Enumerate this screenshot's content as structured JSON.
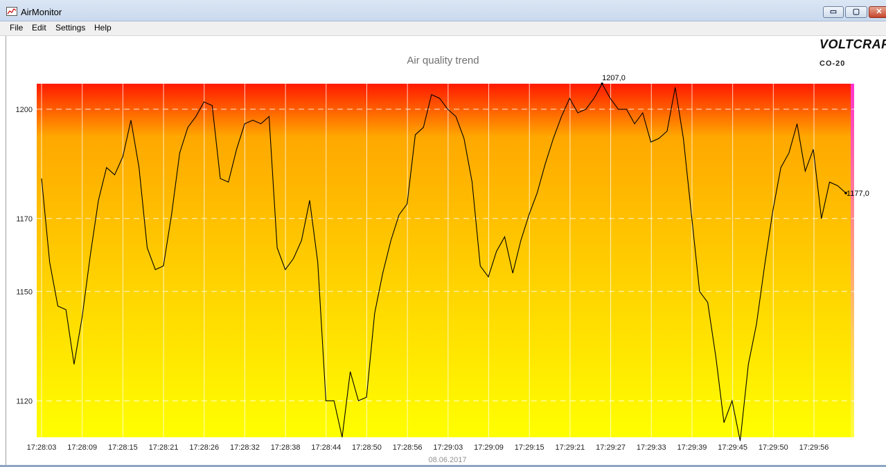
{
  "window": {
    "title": "AirMonitor",
    "min_glyph": "▭",
    "max_glyph": "▢",
    "close_glyph": "✕"
  },
  "menu": [
    "File",
    "Edit",
    "Settings",
    "Help"
  ],
  "brand": {
    "name": "VOLTCRAFT",
    "model": "CO-20"
  },
  "colors": {
    "gradient_top": "#ff1a00",
    "gradient_mid": "#ffa800",
    "gradient_bottom": "#ffff00",
    "right_edge": "#ff33cc",
    "line": "#000000"
  },
  "chart_data": {
    "type": "line",
    "title": "Air quality trend",
    "xlabel": "08.06.2017",
    "ylabel": "",
    "ylim": [
      1110,
      1207
    ],
    "yticks": [
      1120,
      1150,
      1170,
      1200
    ],
    "grid": true,
    "xtick_labels": [
      "17:28:03",
      "17:28:09",
      "17:28:15",
      "17:28:21",
      "17:28:26",
      "17:28:32",
      "17:28:38",
      "17:28:44",
      "17:28:50",
      "17:28:56",
      "17:29:03",
      "17:29:09",
      "17:29:15",
      "17:29:21",
      "17:29:27",
      "17:29:33",
      "17:29:39",
      "17:29:45",
      "17:29:50",
      "17:29:56"
    ],
    "values": [
      1181,
      1158,
      1146,
      1145,
      1130,
      1143,
      1160,
      1175,
      1184,
      1182,
      1187,
      1197,
      1184,
      1162,
      1156,
      1157,
      1171,
      1188,
      1195,
      1198,
      1202,
      1201,
      1181,
      1180,
      1189,
      1196,
      1197,
      1196,
      1198,
      1162,
      1156,
      1159,
      1164,
      1175,
      1158,
      1120,
      1120,
      1110,
      1128,
      1120,
      1121,
      1144,
      1155,
      1164,
      1171,
      1174,
      1193,
      1195,
      1204,
      1203,
      1200,
      1198,
      1192,
      1180,
      1157,
      1154,
      1161,
      1165,
      1155,
      1164,
      1171,
      1177,
      1185,
      1192,
      1198,
      1203,
      1199,
      1200,
      1203,
      1207,
      1203,
      1200,
      1200,
      1196,
      1199,
      1191,
      1192,
      1194,
      1206,
      1192,
      1171,
      1150,
      1147,
      1132,
      1114,
      1120,
      1109,
      1130,
      1141,
      1157,
      1172,
      1184,
      1188,
      1196,
      1183,
      1189,
      1170,
      1180,
      1179,
      1177
    ],
    "annotations": [
      {
        "text": "1207,0",
        "index": 69
      },
      {
        "text": "1177,0",
        "index": 99
      }
    ]
  }
}
